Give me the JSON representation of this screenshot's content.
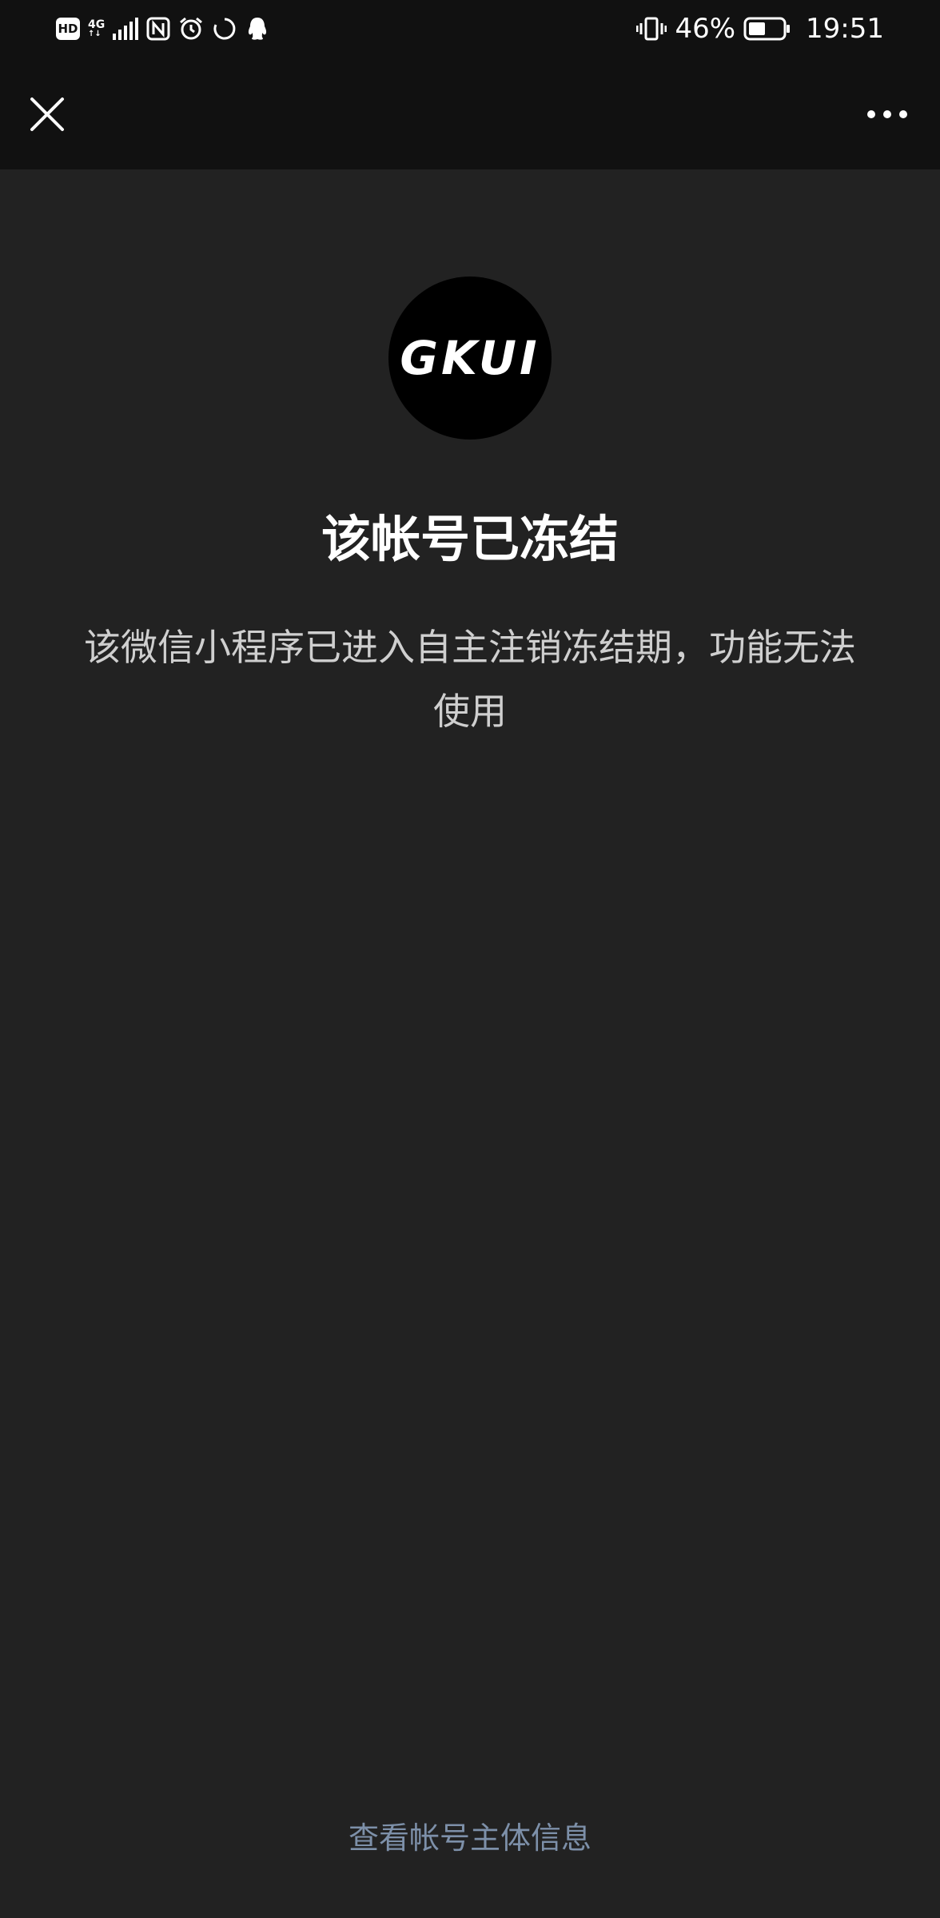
{
  "status_bar": {
    "hd_label": "HD",
    "network_label": "4G",
    "network_sub": "↑↓",
    "battery_percent": "46%",
    "time": "19:51"
  },
  "nav": {
    "close_icon": "close-icon",
    "more_icon": "more-icon"
  },
  "logo": {
    "text": "GKUI"
  },
  "main": {
    "title": "该帐号已冻结",
    "description": "该微信小程序已进入自主注销冻结期，功能无法使用"
  },
  "footer": {
    "link_label": "查看帐号主体信息"
  },
  "colors": {
    "background": "#222222",
    "bar": "#111111",
    "link": "#7d90a9"
  }
}
